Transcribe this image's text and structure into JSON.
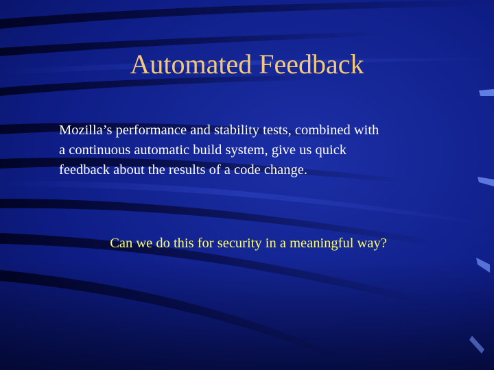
{
  "slide": {
    "title": "Automated Feedback",
    "body_lines": [
      "Mozilla’s performance and stability tests, combined with",
      "a continuous automatic build system, give us quick",
      "feedback about the results of a code change."
    ],
    "question": "Can we do this for security in a meaningful way?"
  },
  "colors": {
    "background": "#0b1776",
    "title": "#f6c976",
    "body": "#ffffff",
    "question": "#ffff66"
  }
}
